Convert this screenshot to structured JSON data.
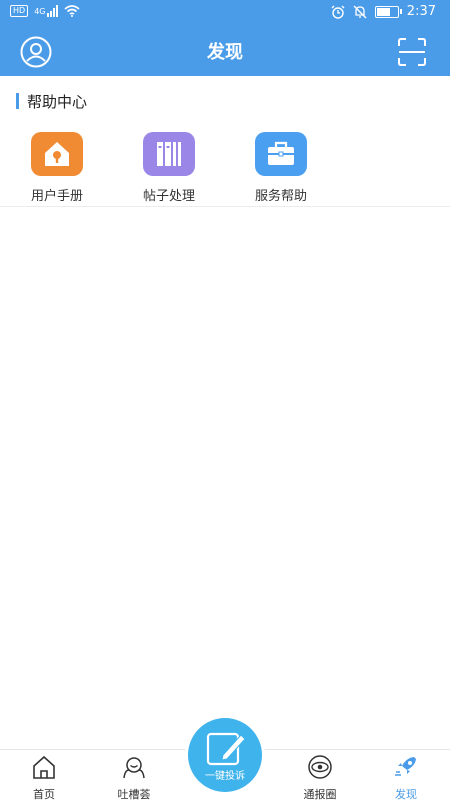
{
  "status_bar": {
    "network": "4G",
    "hd": "HD",
    "time": "2:37"
  },
  "header": {
    "title": "发现"
  },
  "help_center": {
    "title": "帮助中心",
    "items": [
      {
        "label": "用户手册",
        "icon": "house-key-icon",
        "color": "#f08a33"
      },
      {
        "label": "帖子处理",
        "icon": "books-icon",
        "color": "#9a86e6"
      },
      {
        "label": "服务帮助",
        "icon": "toolbox-icon",
        "color": "#4a9ff0"
      }
    ]
  },
  "tabbar": {
    "items": [
      {
        "label": "首页",
        "icon": "home-icon"
      },
      {
        "label": "吐槽荟",
        "icon": "face-icon"
      },
      {
        "label": "一键投诉",
        "icon": "pencil-edit-icon"
      },
      {
        "label": "通报圈",
        "icon": "eye-circle-icon"
      },
      {
        "label": "发现",
        "icon": "rocket-icon"
      }
    ],
    "active": "发现"
  },
  "colors": {
    "primary": "#4b9ce8",
    "fab": "#3fb3ec"
  }
}
